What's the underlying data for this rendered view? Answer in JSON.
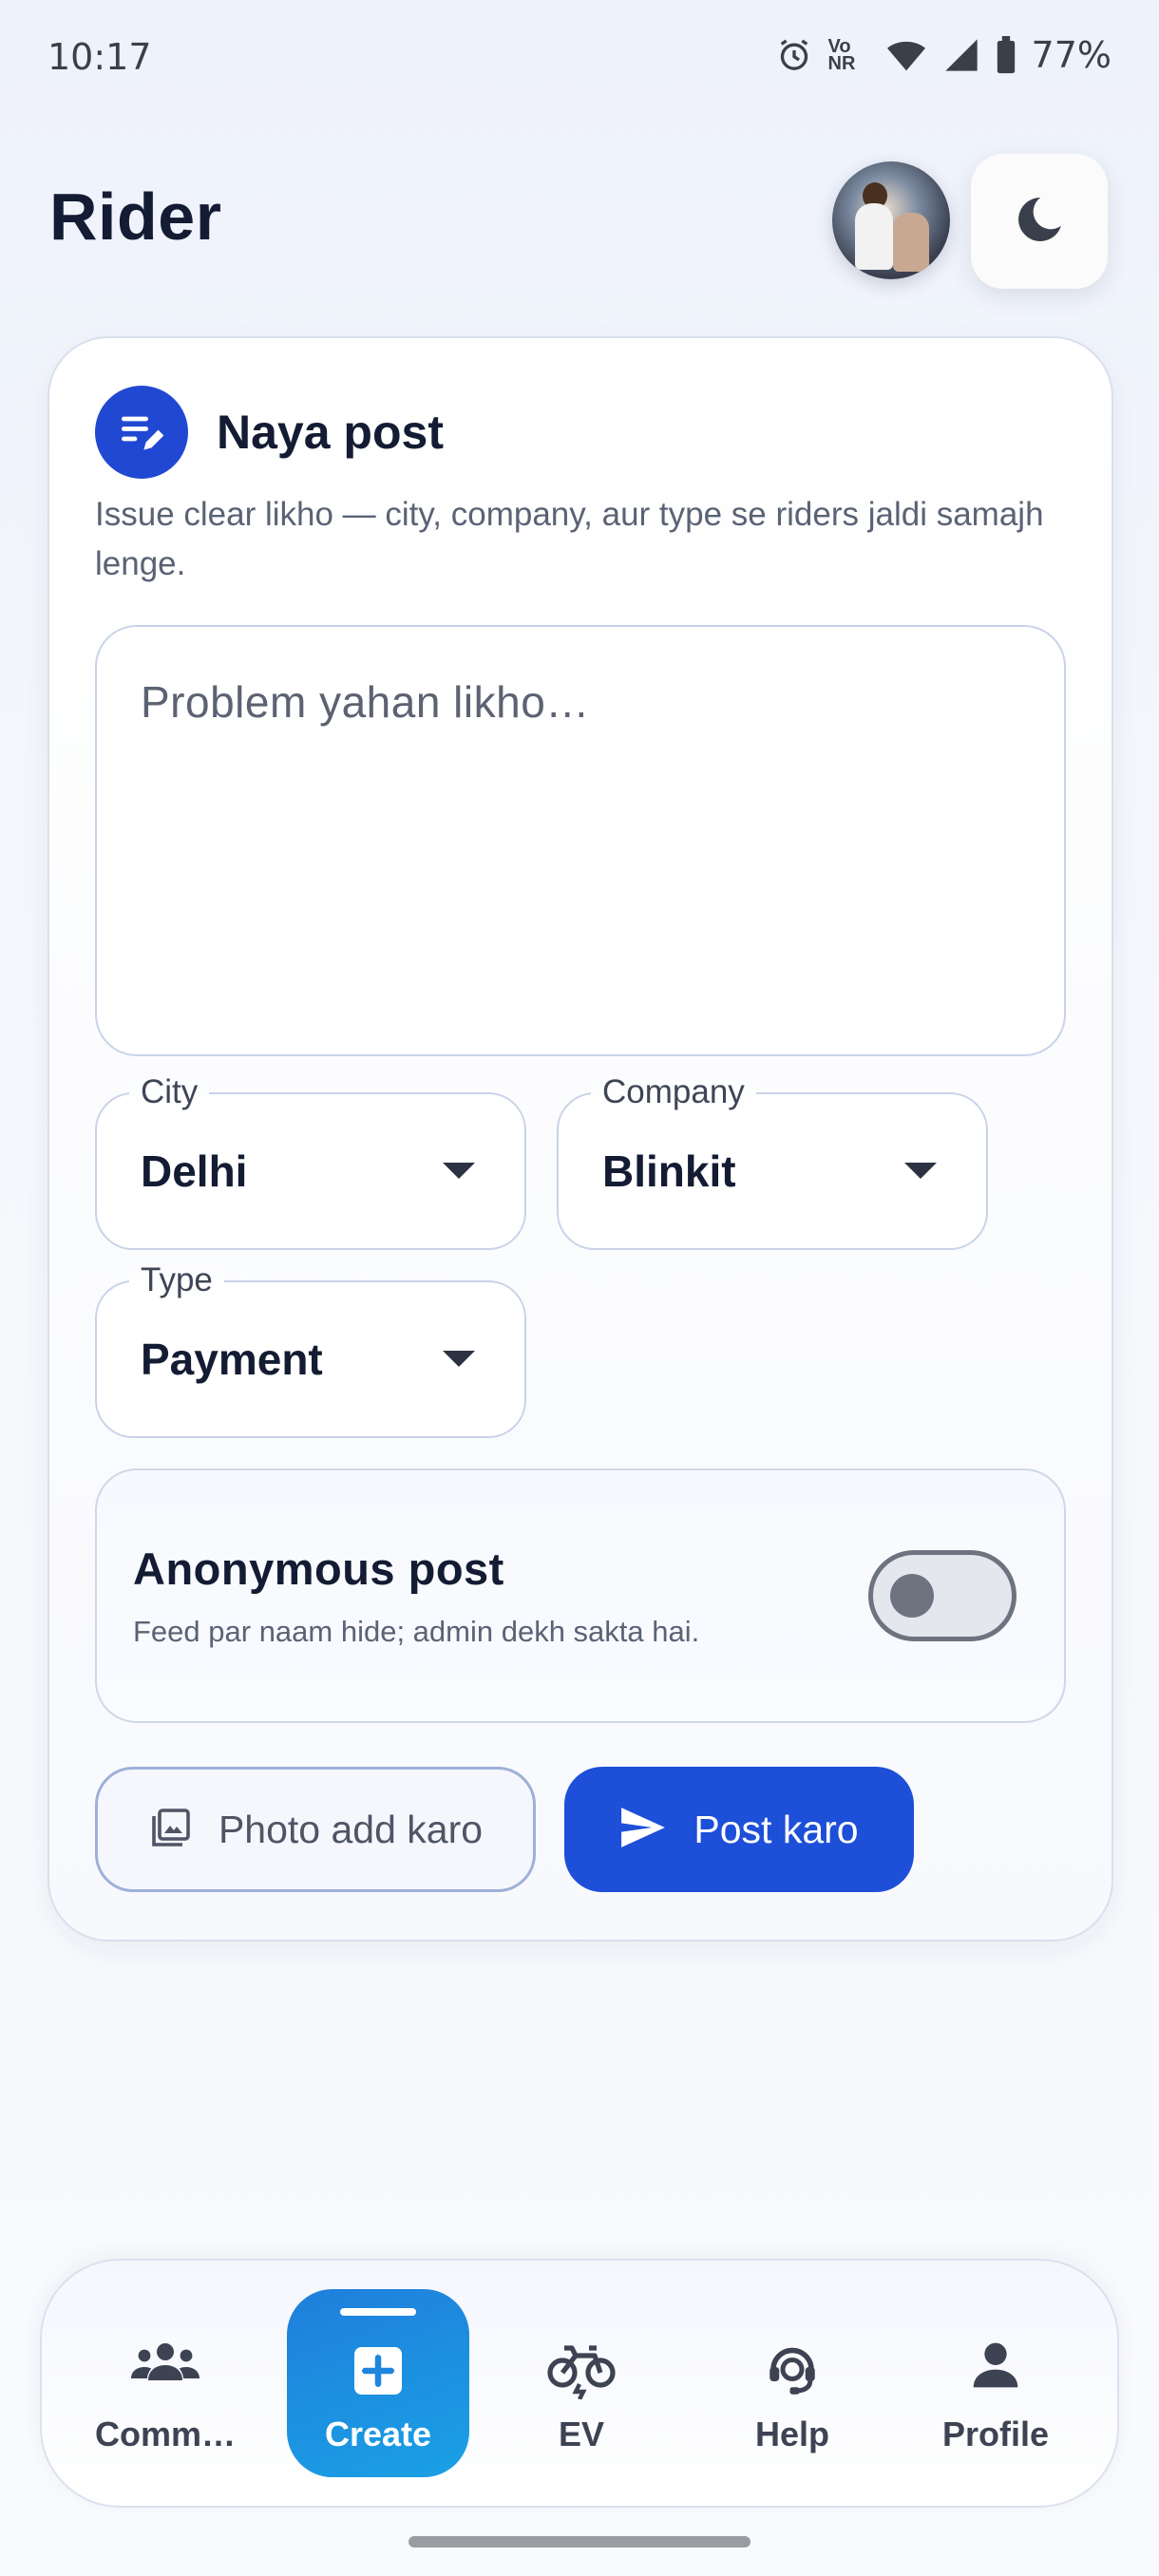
{
  "status_bar": {
    "time": "10:17",
    "network_label": "Vo NR",
    "battery": "77%",
    "icons": [
      "alarm-icon",
      "volte-icon",
      "wifi-icon",
      "signal-icon",
      "battery-icon"
    ]
  },
  "header": {
    "title": "Rider",
    "avatar_icon": "avatar",
    "theme_icon": "moon-icon"
  },
  "new_post": {
    "title": "Naya post",
    "subtitle": "Issue clear likho — city, company, aur type se riders jaldi samajh lenge.",
    "icon": "edit-note-icon",
    "problem_placeholder": "Problem yahan likho…",
    "problem_value": "",
    "city": {
      "label": "City",
      "value": "Delhi"
    },
    "company": {
      "label": "Company",
      "value": "Blinkit"
    },
    "type": {
      "label": "Type",
      "value": "Payment"
    },
    "anonymous": {
      "title": "Anonymous post",
      "subtitle": "Feed par naam hide; admin dekh sakta hai.",
      "enabled": false
    },
    "photo_button": "Photo add karo",
    "post_button": "Post karo"
  },
  "bottom_nav": {
    "items": [
      {
        "label": "Comm…",
        "icon": "community-icon",
        "active": false
      },
      {
        "label": "Create",
        "icon": "add-box-icon",
        "active": true
      },
      {
        "label": "EV",
        "icon": "ev-bike-icon",
        "active": false
      },
      {
        "label": "Help",
        "icon": "support-agent-icon",
        "active": false
      },
      {
        "label": "Profile",
        "icon": "person-icon",
        "active": false
      }
    ]
  },
  "colors": {
    "accent": "#1d4fd8",
    "create_tab": "#1f7fdc",
    "text_primary": "#131c33",
    "text_secondary": "#5a6375"
  }
}
